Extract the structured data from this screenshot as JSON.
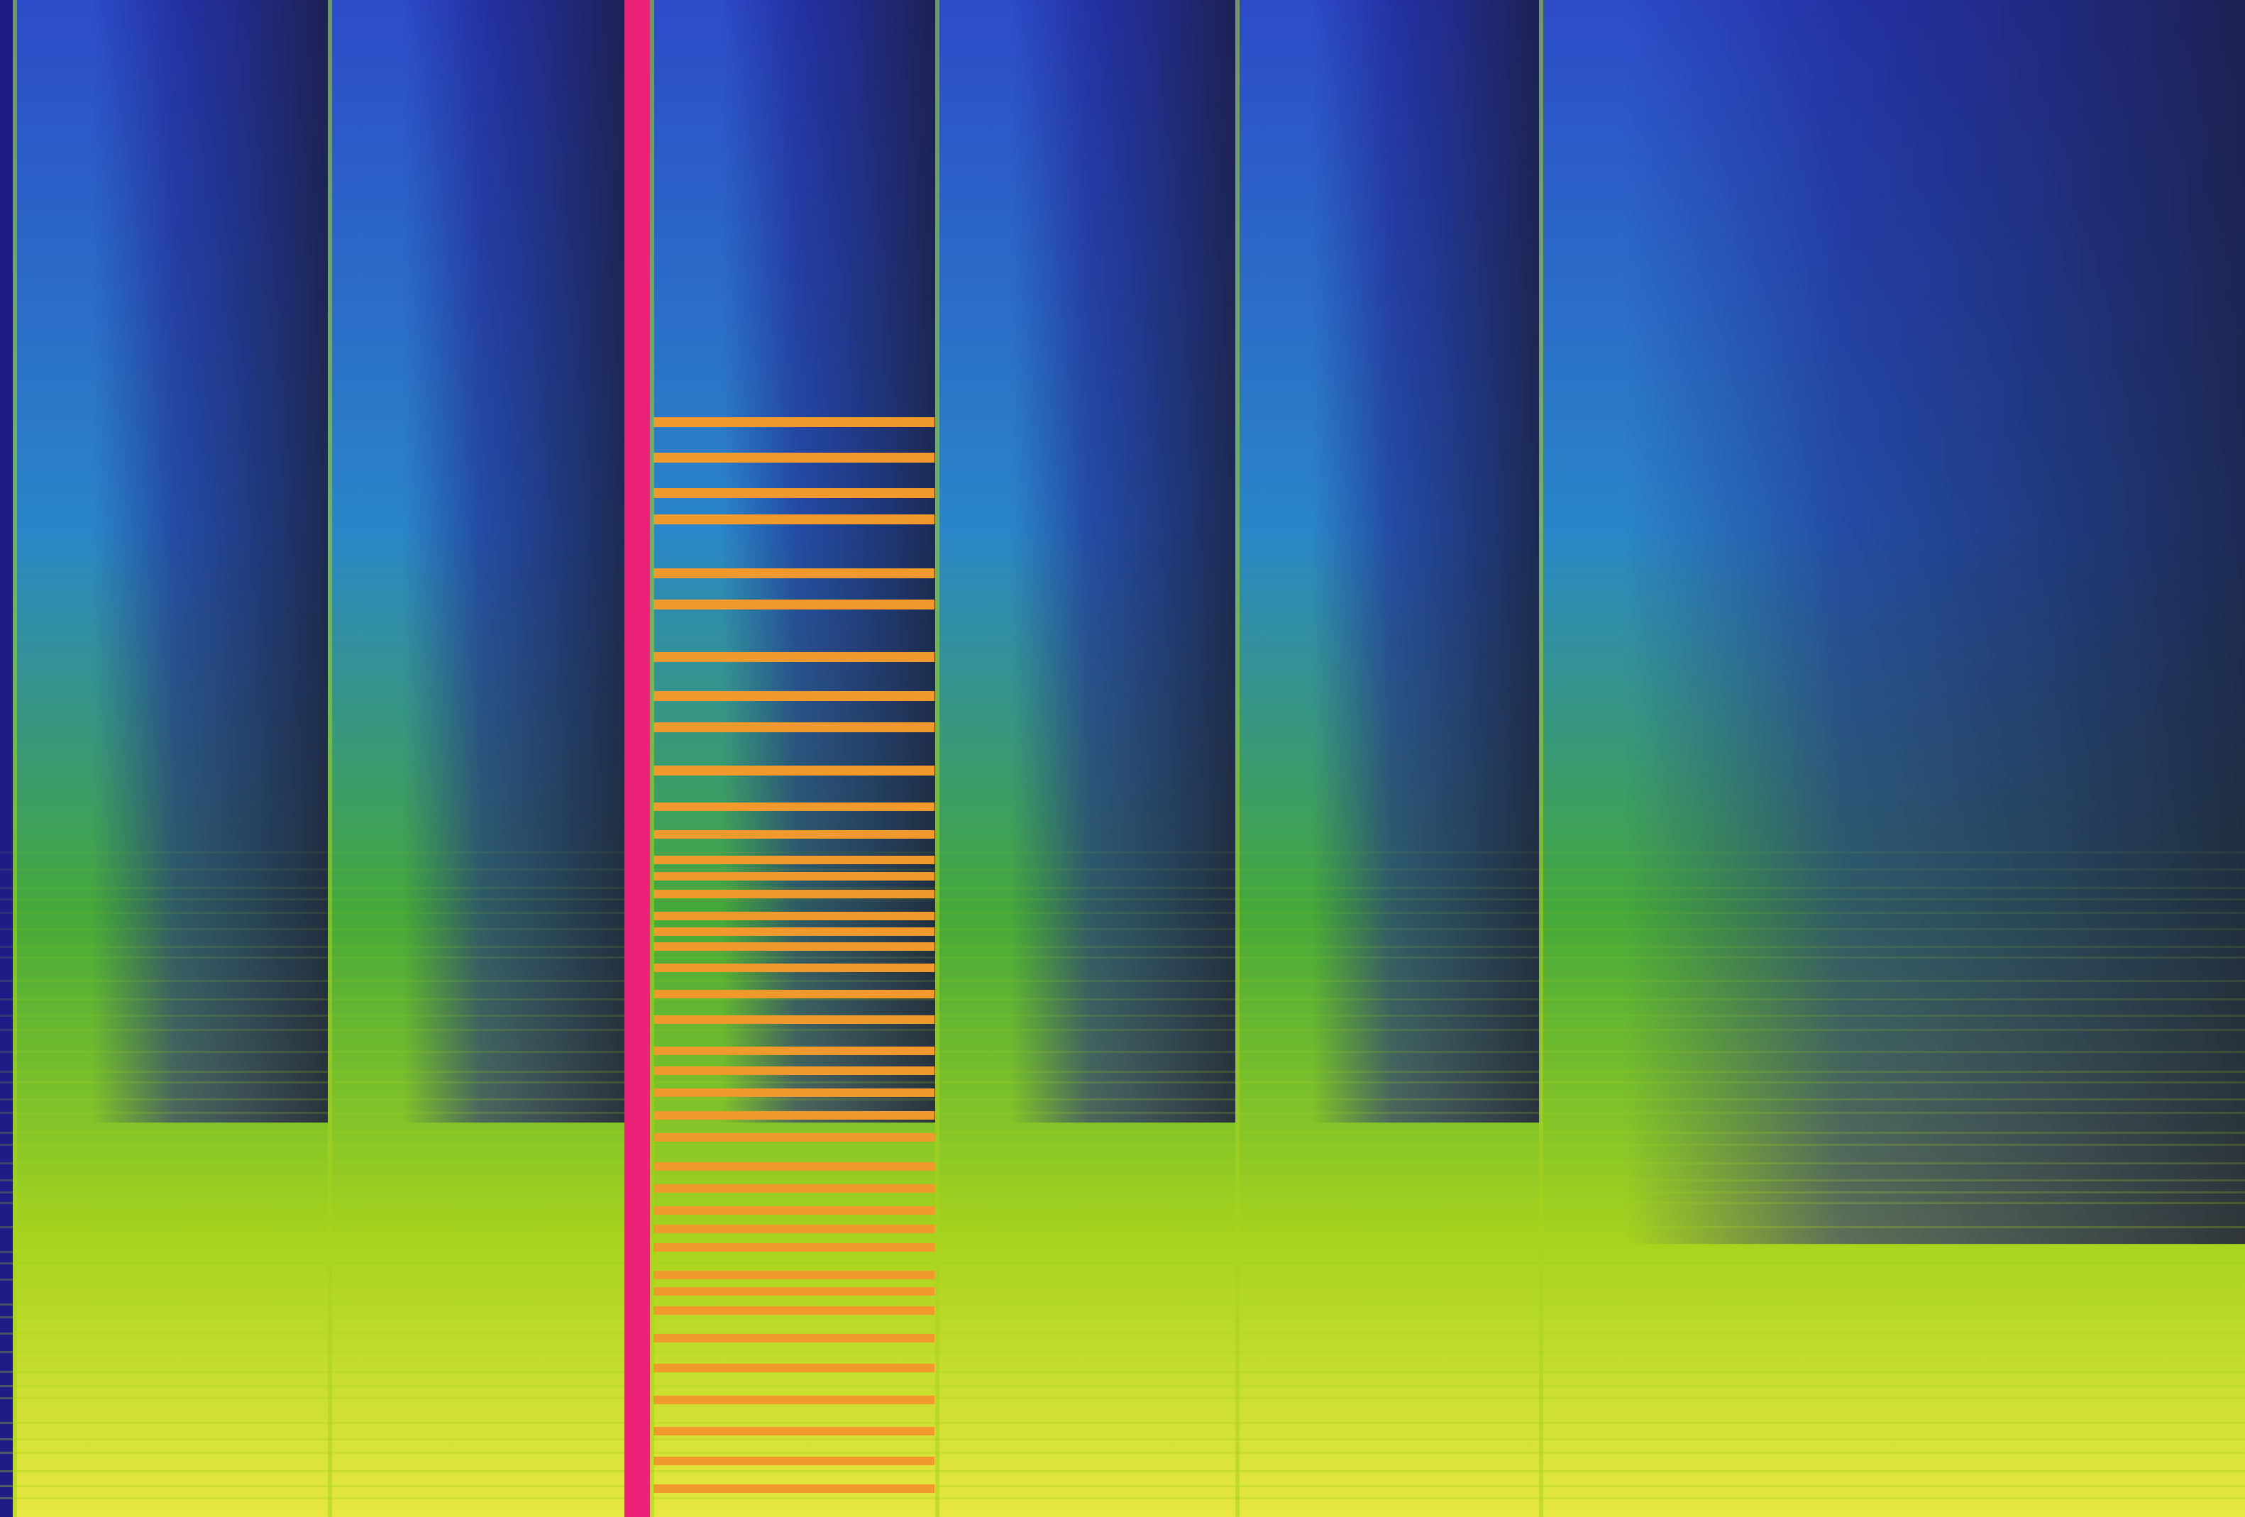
{
  "colors": {
    "background": "#1a1a3e",
    "deep_blue": "#1e1c86",
    "mid_blue": "#2c4bc8",
    "cyan_blue": "#2a86c8",
    "green": "#44a83a",
    "yellow_green": "#a8d41e",
    "yellow": "#e8e840",
    "playhead": "#ec2178",
    "selection_band": "#f2992e"
  },
  "spectrogram": {
    "segment_count": 6,
    "playhead_count": 1,
    "selection_present": true
  }
}
